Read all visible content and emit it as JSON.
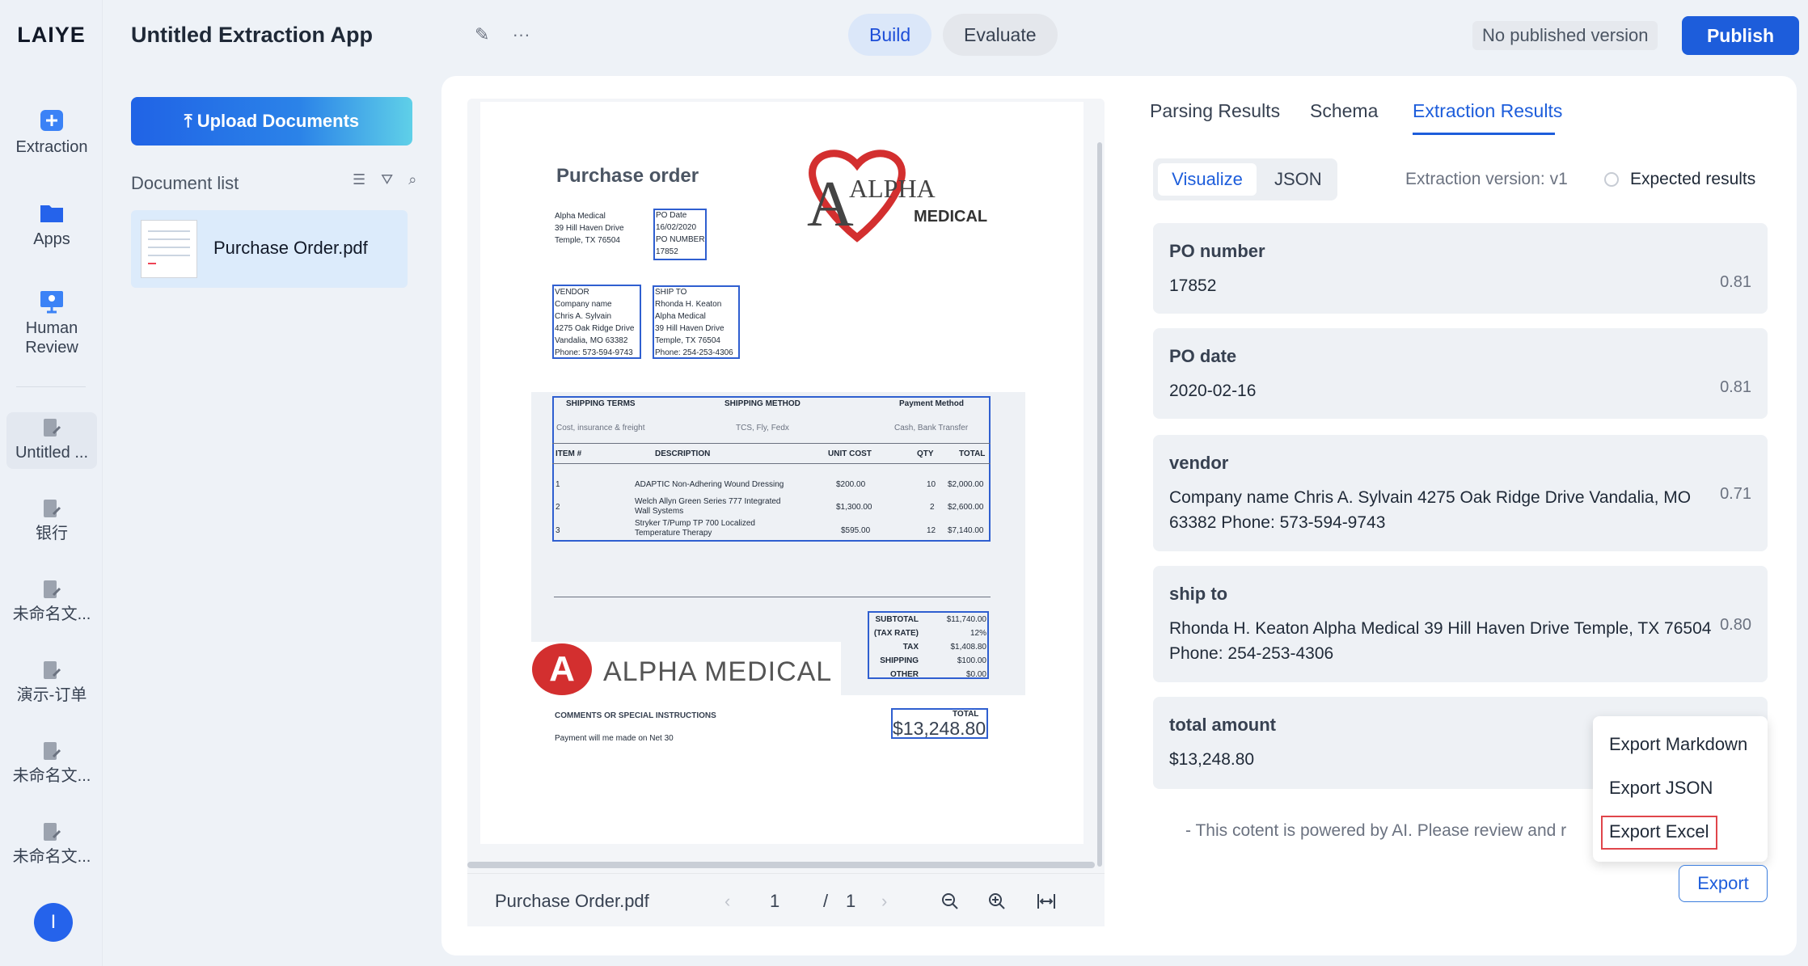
{
  "brand": {
    "logo": "LAIYE",
    "accent": "#1d5ddb"
  },
  "rail": {
    "items": [
      {
        "label": "Extraction",
        "icon": "extraction-icon"
      },
      {
        "label": "Apps",
        "icon": "apps-icon"
      },
      {
        "label": "Human Review",
        "icon": "human-review-icon"
      }
    ],
    "recent": [
      "Untitled ...",
      "银行",
      "未命名文...",
      "演示-订单",
      "未命名文...",
      "未命名文..."
    ],
    "avatar": "I"
  },
  "header": {
    "app_title": "Untitled Extraction App",
    "build": "Build",
    "evaluate": "Evaluate",
    "version_status": "No published version",
    "publish": "Publish"
  },
  "documents": {
    "upload": "Upload Documents",
    "list_label": "Document list",
    "items": [
      {
        "name": "Purchase Order.pdf"
      }
    ]
  },
  "viewer": {
    "file_name": "Purchase Order.pdf",
    "page": "1",
    "page_sep": "/",
    "total_pages": "1",
    "doc": {
      "title": "Purchase order",
      "company": [
        "Alpha Medical",
        "39 Hill Haven Drive",
        "Temple, TX 76504"
      ],
      "po_box": [
        "PO Date",
        "16/02/2020",
        "PO NUMBER",
        "17852"
      ],
      "vendor": [
        "VENDOR",
        "Company name",
        "Chris A. Sylvain",
        "4275 Oak Ridge Drive",
        "Vandalia, MO 63382",
        "Phone: 573-594-9743"
      ],
      "ship_to": [
        "SHIP TO",
        "Rhonda H. Keaton",
        "Alpha Medical",
        "39 Hill Haven Drive",
        "Temple, TX 76504",
        "Phone: 254-253-4306"
      ],
      "logo_word": "ALPHA",
      "logo_sub": "MEDICAL",
      "terms_headers": [
        "SHIPPING TERMS",
        "SHIPPING METHOD",
        "Payment Method"
      ],
      "terms_values": [
        "Cost, insurance & freight",
        "TCS, Fly, Fedx",
        "Cash, Bank Transfer"
      ],
      "item_headers": [
        "ITEM #",
        "DESCRIPTION",
        "UNIT COST",
        "QTY",
        "TOTAL"
      ],
      "items": [
        [
          "1",
          "ADAPTIC Non-Adhering Wound Dressing",
          "$200.00",
          "10",
          "$2,000.00"
        ],
        [
          "2",
          "Welch Allyn Green Series 777 Integrated Wall Systems",
          "$1,300.00",
          "2",
          "$2,600.00"
        ],
        [
          "3",
          "Stryker T/Pump TP 700 Localized Temperature Therapy",
          "$595.00",
          "12",
          "$7,140.00"
        ]
      ],
      "summary": [
        [
          "SUBTOTAL",
          "$11,740.00"
        ],
        [
          "(TAX RATE)",
          "12%"
        ],
        [
          "TAX",
          "$1,408.80"
        ],
        [
          "SHIPPING",
          "$100.00"
        ],
        [
          "OTHER",
          "$0.00"
        ]
      ],
      "banner": "ALPHA MEDICAL",
      "banner_letter": "A",
      "comments_label": "COMMENTS OR SPECIAL INSTRUCTIONS",
      "comments": "Payment will me made on Net 30",
      "total_label": "TOTAL",
      "total": "$13,248.80"
    }
  },
  "results": {
    "tabs": [
      "Parsing Results",
      "Schema",
      "Extraction Results"
    ],
    "view_visualize": "Visualize",
    "view_json": "JSON",
    "extraction_version": "Extraction version: v1",
    "expected": "Expected results",
    "fields": [
      {
        "label": "PO number",
        "value": "17852",
        "score": "0.81"
      },
      {
        "label": "PO date",
        "value": "2020-02-16",
        "score": "0.81"
      },
      {
        "label": "vendor",
        "value": "Company name Chris A. Sylvain 4275 Oak Ridge Drive Vandalia, MO 63382 Phone: 573-594-9743",
        "score": "0.71"
      },
      {
        "label": "ship to",
        "value": "Rhonda H. Keaton Alpha Medical 39 Hill Haven Drive Temple, TX 76504 Phone: 254-253-4306",
        "score": "0.80"
      },
      {
        "label": "total amount",
        "value": "$13,248.80",
        "score": ""
      }
    ],
    "disclaimer": "- This cotent is powered by AI. Please review and r",
    "export_menu": [
      "Export Markdown",
      "Export JSON",
      "Export Excel"
    ],
    "export": "Export"
  }
}
